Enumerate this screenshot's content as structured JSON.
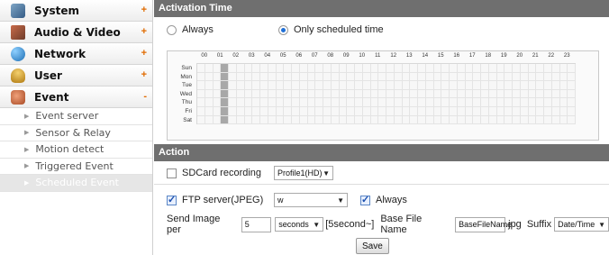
{
  "sidebar": {
    "items": [
      {
        "label": "System",
        "icon": "system-icon",
        "toggle": "+"
      },
      {
        "label": "Audio & Video",
        "icon": "audio-video-icon",
        "toggle": "+"
      },
      {
        "label": "Network",
        "icon": "network-icon",
        "toggle": "+"
      },
      {
        "label": "User",
        "icon": "user-icon",
        "toggle": "+"
      },
      {
        "label": "Event",
        "icon": "event-icon",
        "toggle": "-"
      }
    ],
    "sub_items": [
      {
        "label": "Event server",
        "active": false
      },
      {
        "label": "Sensor & Relay",
        "active": false
      },
      {
        "label": "Motion detect",
        "active": false
      },
      {
        "label": "Triggered Event",
        "active": false
      },
      {
        "label": "Scheduled Event",
        "active": true
      }
    ]
  },
  "activation": {
    "title": "Activation Time",
    "always_label": "Always",
    "scheduled_label": "Only scheduled time",
    "selected": "scheduled",
    "hours": [
      "00",
      "01",
      "02",
      "03",
      "04",
      "05",
      "06",
      "07",
      "08",
      "09",
      "10",
      "11",
      "12",
      "13",
      "14",
      "15",
      "16",
      "17",
      "18",
      "19",
      "20",
      "21",
      "22",
      "23"
    ],
    "days": [
      "Sun",
      "Mon",
      "Tue",
      "Wed",
      "Thu",
      "Fri",
      "Sat"
    ],
    "active_half_hour_column": 3
  },
  "action": {
    "title": "Action",
    "sdcard": {
      "label": "SDCard recording",
      "checked": false,
      "profile": "Profile1(HD)"
    },
    "ftp": {
      "label": "FTP server(JPEG)",
      "checked": true,
      "server": "w",
      "always_label": "Always",
      "always_checked": true
    },
    "send": {
      "label": "Send Image per",
      "value": "5",
      "unit": "seconds",
      "hint": "[5second~]",
      "base_label": "Base File Name",
      "base_value": "BaseFileName",
      "ext": ".jpg",
      "suffix_label": "Suffix",
      "suffix_value": "Date/Time"
    },
    "save_label": "Save"
  },
  "colors": {
    "section_header": "#6f6f6f",
    "accent_orange": "#e06a00",
    "radio_blue": "#1f6fd6",
    "grid_on": "#a8a8a8"
  }
}
